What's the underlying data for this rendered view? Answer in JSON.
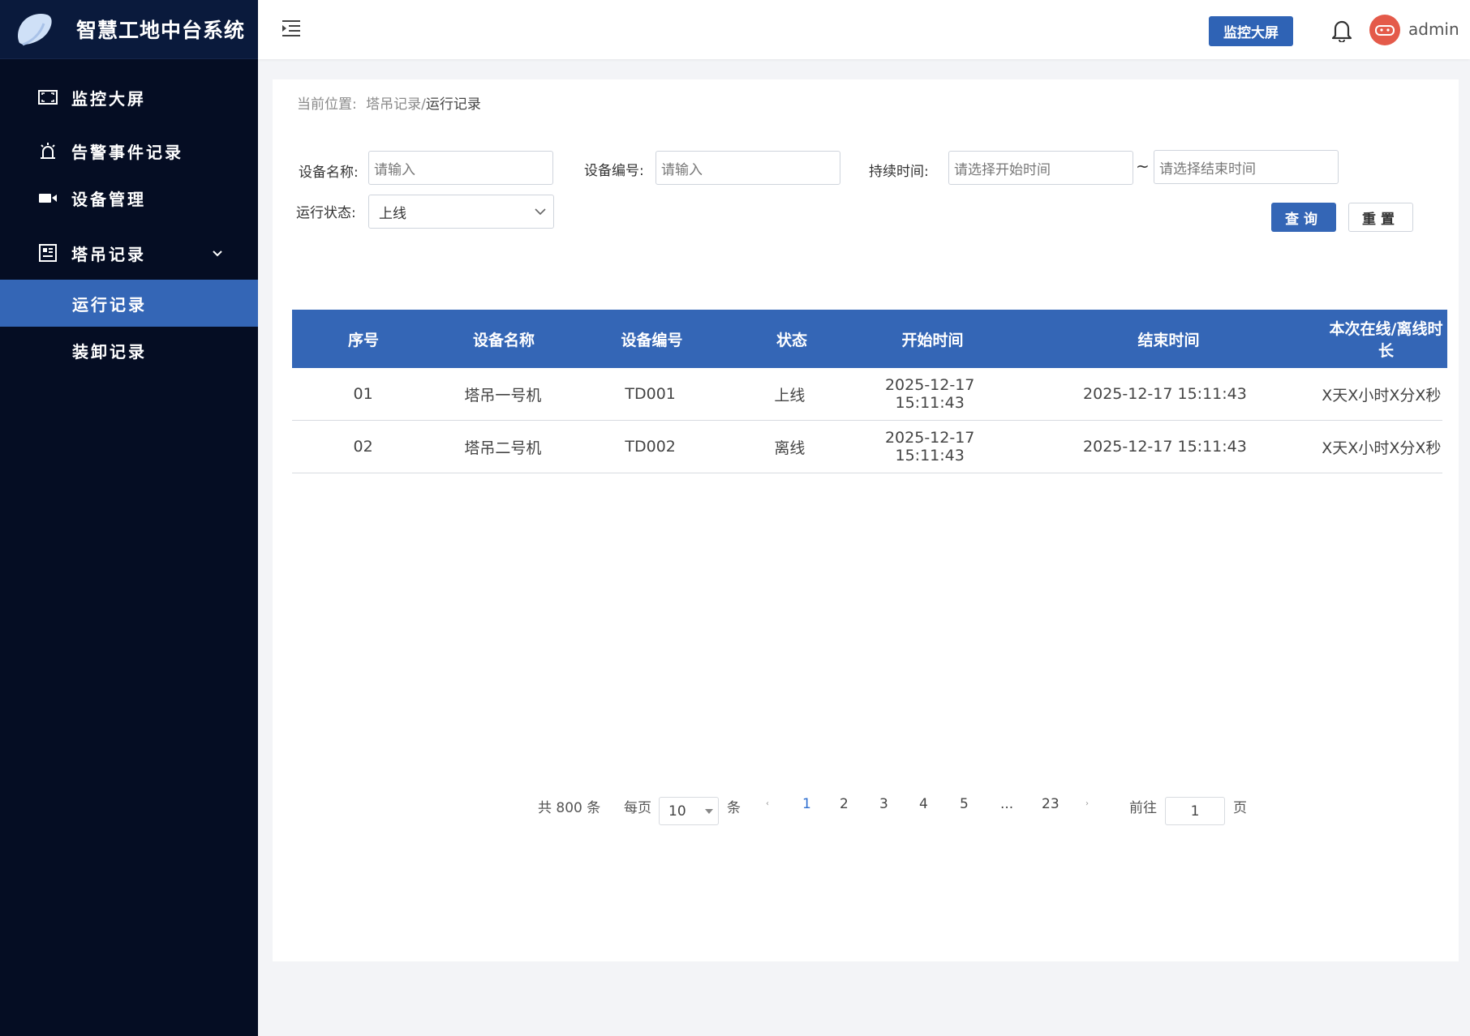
{
  "brand": {
    "title": "智慧工地中台系统"
  },
  "sidebar": {
    "items": [
      {
        "label": "监控大屏",
        "icon": "screen-icon"
      },
      {
        "label": "告警事件记录",
        "icon": "alarm-icon"
      },
      {
        "label": "设备管理",
        "icon": "camera-icon"
      },
      {
        "label": "塔吊记录",
        "icon": "record-icon"
      }
    ],
    "sub_items": [
      {
        "label": "运行记录",
        "active": true
      },
      {
        "label": "装卸记录",
        "active": false
      }
    ]
  },
  "header": {
    "screen_button": "监控大屏",
    "username": "admin"
  },
  "breadcrumb": {
    "prefix": "当前位置:",
    "parent": "塔吊记录/",
    "current": "运行记录"
  },
  "filters": {
    "device_name_label": "设备名称:",
    "device_name_placeholder": "请输入",
    "device_code_label": "设备编号:",
    "device_code_placeholder": "请输入",
    "duration_label": "持续时间:",
    "start_placeholder": "请选择开始时间",
    "end_placeholder": "请选择结束时间",
    "range_separator": "~",
    "status_label": "运行状态:",
    "status_value": "上线",
    "query_button": "查询",
    "reset_button": "重置"
  },
  "table": {
    "columns": [
      "序号",
      "设备名称",
      "设备编号",
      "状态",
      "开始时间",
      "结束时间",
      "本次在线/离线时长"
    ],
    "rows": [
      [
        "01",
        "塔吊一号机",
        "TD001",
        "上线",
        "2025-12-17  15:11:43",
        "2025-12-17  15:11:43",
        "X天X小时X分X秒"
      ],
      [
        "02",
        "塔吊二号机",
        "TD002",
        "离线",
        "2025-12-17  15:11:43",
        "2025-12-17  15:11:43",
        "X天X小时X分X秒"
      ]
    ]
  },
  "pagination": {
    "total_text": "共 800 条",
    "per_page_label": "每页",
    "per_page_value": "10",
    "per_page_unit": "条",
    "pages": [
      "1",
      "2",
      "3",
      "4",
      "5",
      "...",
      "23"
    ],
    "current_page": "1",
    "goto_label": "前往",
    "goto_value": "1",
    "goto_unit": "页"
  },
  "colors": {
    "sidebar_bg": "#050d23",
    "accent": "#3466b6",
    "avatar": "#e45a4a"
  }
}
